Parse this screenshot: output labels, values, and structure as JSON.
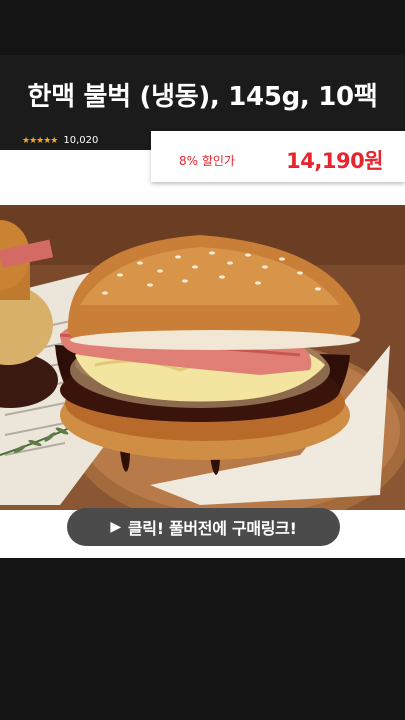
{
  "product": {
    "title": "한맥 불벅 (냉동), 145g, 10팩",
    "rating_stars": "★★★★★",
    "review_count": "10,020",
    "discount_label": "8% 할인가",
    "price": "14,190원"
  },
  "cta": {
    "icon": "play-icon",
    "label": "클릭! 풀버전에 구매링크!"
  },
  "colors": {
    "background": "#141414",
    "accent_price": "#e8252f",
    "star": "#f0a81e",
    "cta_bg": "#4b4b4b"
  },
  "image": {
    "subject": "burger-photo"
  }
}
